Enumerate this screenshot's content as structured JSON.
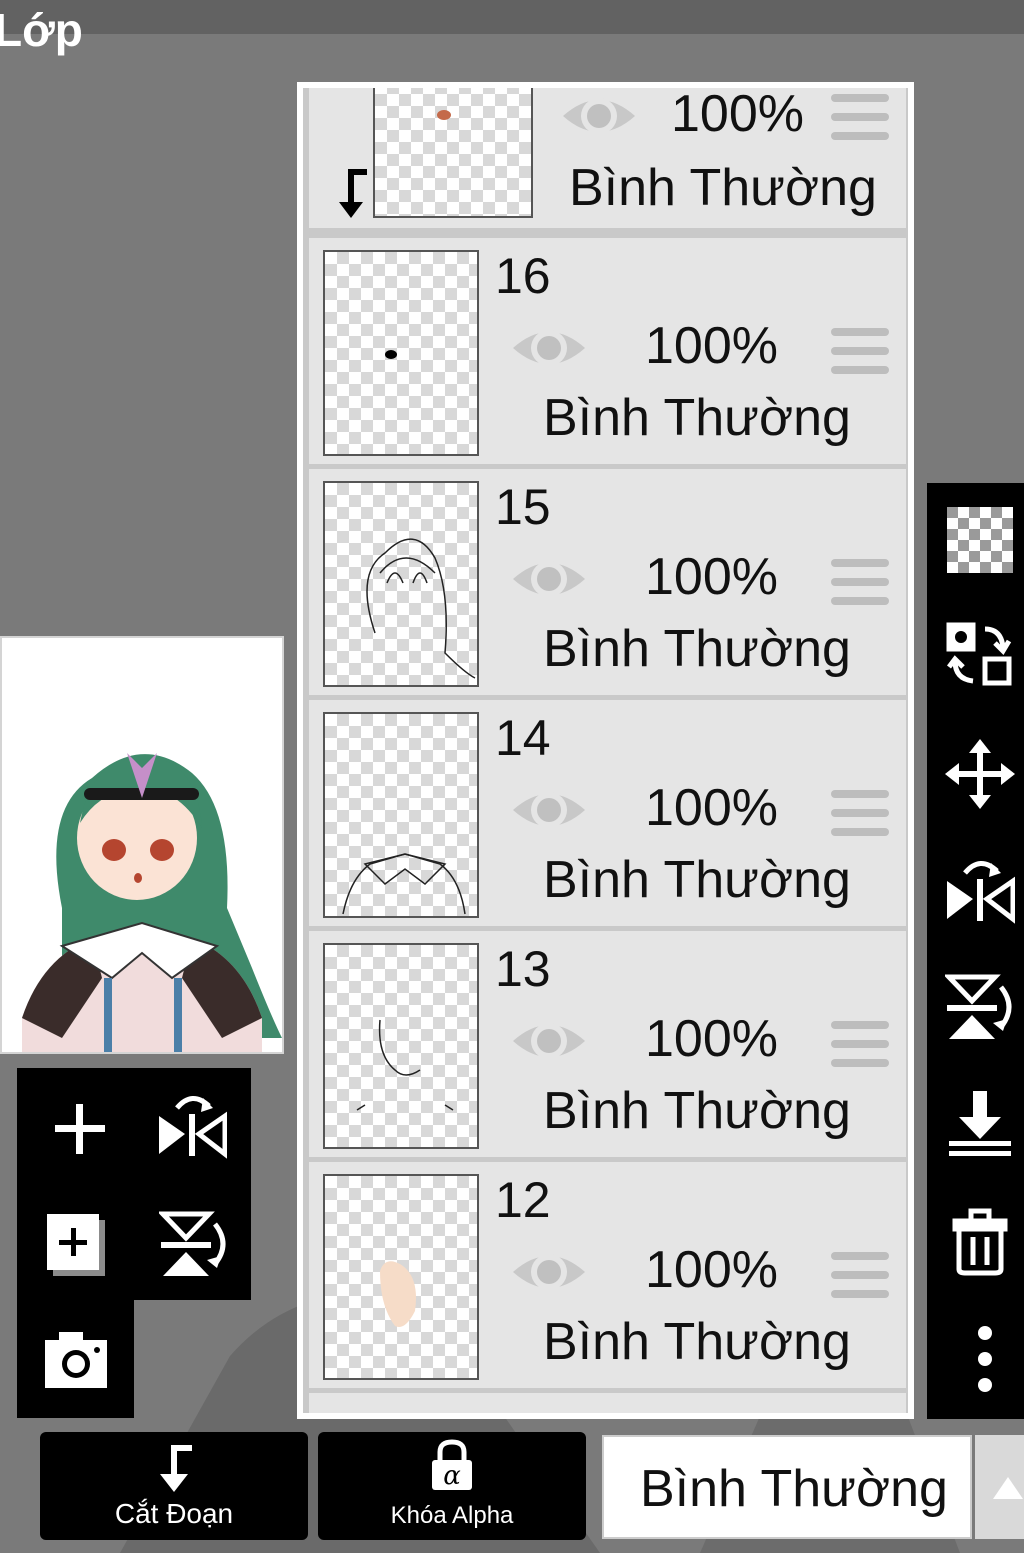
{
  "app": {
    "title": "Lớp"
  },
  "top_layer": {
    "opacity": "100%",
    "blend": "Bình Thường"
  },
  "layers": [
    {
      "number": "16",
      "opacity": "100%",
      "blend": "Bình Thường"
    },
    {
      "number": "15",
      "opacity": "100%",
      "blend": "Bình Thường"
    },
    {
      "number": "14",
      "opacity": "100%",
      "blend": "Bình Thường"
    },
    {
      "number": "13",
      "opacity": "100%",
      "blend": "Bình Thường"
    },
    {
      "number": "12",
      "opacity": "100%",
      "blend": "Bình Thường"
    }
  ],
  "right_toolbar": [
    "transparency-icon",
    "swap-layers-icon",
    "move-icon",
    "flip-horizontal-icon",
    "flip-vertical-icon",
    "merge-down-icon",
    "trash-icon",
    "more-icon"
  ],
  "left_toolbar": [
    "add-layer-icon",
    "flip-horizontal-icon",
    "duplicate-layer-icon",
    "flip-vertical-icon",
    "camera-icon"
  ],
  "bottom_bar": {
    "clip_label": "Cắt Đoạn",
    "alpha_lock_label": "Khóa Alpha",
    "blend_mode": "Bình Thường"
  },
  "colors": {
    "panel_bg": "#e5e5e5",
    "toolbar_bg": "#000000",
    "background": "#7a7a7a"
  }
}
